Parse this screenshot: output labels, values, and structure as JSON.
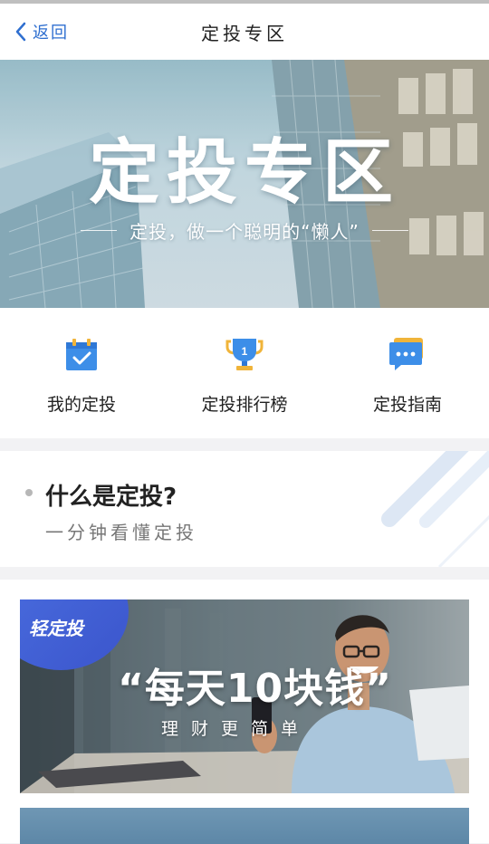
{
  "nav": {
    "back_label": "返回",
    "title": "定投专区"
  },
  "hero": {
    "title": "定投专区",
    "subtitle": "定投，做一个聪明的“懒人”"
  },
  "quick_actions": [
    {
      "label": "我的定投",
      "icon": "calendar-check-icon"
    },
    {
      "label": "定投排行榜",
      "icon": "trophy-icon"
    },
    {
      "label": "定投指南",
      "icon": "chat-bubble-icon"
    }
  ],
  "whatis": {
    "title": "什么是定投?",
    "subtitle": "一分钟看懂定投"
  },
  "promo": {
    "badge": "轻定投",
    "title": "“每天10块钱”",
    "subtitle": "理财更简单"
  },
  "colors": {
    "accent": "#2f6fd0",
    "icon_blue": "#3d8ee8",
    "badge_blue": "#4561d8"
  }
}
